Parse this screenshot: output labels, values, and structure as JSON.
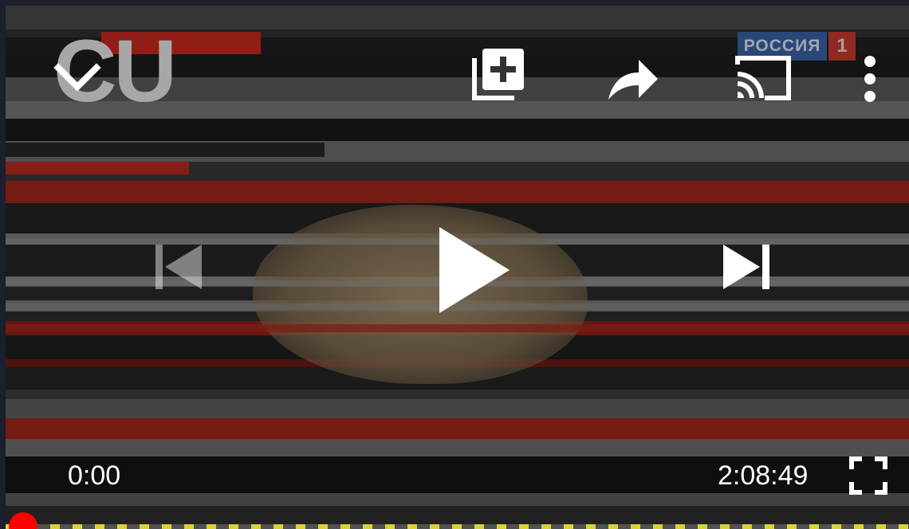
{
  "player": {
    "current_time": "0:00",
    "duration": "2:08:49",
    "progress": 0,
    "paused": true,
    "accent_color": "#ff0000",
    "buffered_color": "#d8d03a"
  },
  "video_frame": {
    "channel_logo": {
      "text": "РОССИЯ",
      "number": "1"
    },
    "headline_fragment": "CU"
  },
  "controls": {
    "top": [
      "chevron-down-icon",
      "add-to-playlist-icon",
      "share-icon",
      "cast-icon",
      "more-vert-icon"
    ],
    "center": [
      "previous-icon",
      "play-icon",
      "next-icon"
    ],
    "bottom": [
      "fullscreen-icon"
    ]
  }
}
